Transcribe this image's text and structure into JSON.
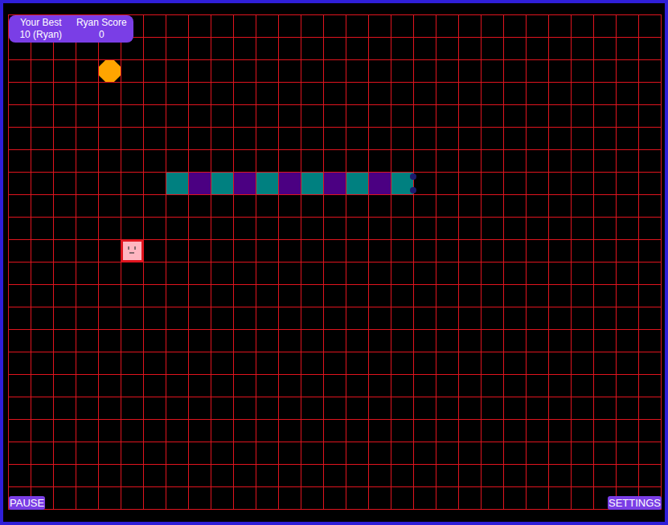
{
  "scoreboard": {
    "best_label": "Your Best",
    "best_value": "10 (Ryan)",
    "score_label": "Ryan Score",
    "score_value": "0"
  },
  "board": {
    "columns": 29,
    "rows": 22
  },
  "snake": {
    "segments": [
      {
        "col": 17,
        "row": 7,
        "color": "#008080"
      },
      {
        "col": 16,
        "row": 7,
        "color": "#4b0082"
      },
      {
        "col": 15,
        "row": 7,
        "color": "#008080"
      },
      {
        "col": 14,
        "row": 7,
        "color": "#4b0082"
      },
      {
        "col": 13,
        "row": 7,
        "color": "#008080"
      },
      {
        "col": 12,
        "row": 7,
        "color": "#4b0082"
      },
      {
        "col": 11,
        "row": 7,
        "color": "#008080"
      },
      {
        "col": 10,
        "row": 7,
        "color": "#4b0082"
      },
      {
        "col": 9,
        "row": 7,
        "color": "#008080"
      },
      {
        "col": 8,
        "row": 7,
        "color": "#4b0082"
      },
      {
        "col": 7,
        "row": 7,
        "color": "#008080"
      }
    ]
  },
  "food": {
    "col": 4,
    "row": 2,
    "color": "#ffa500"
  },
  "obstacle": {
    "col": 5,
    "row": 10,
    "color": "#ffb6c1"
  },
  "buttons": [
    {
      "label": "PAUSE"
    },
    {
      "label": "SETTINGS"
    }
  ]
}
